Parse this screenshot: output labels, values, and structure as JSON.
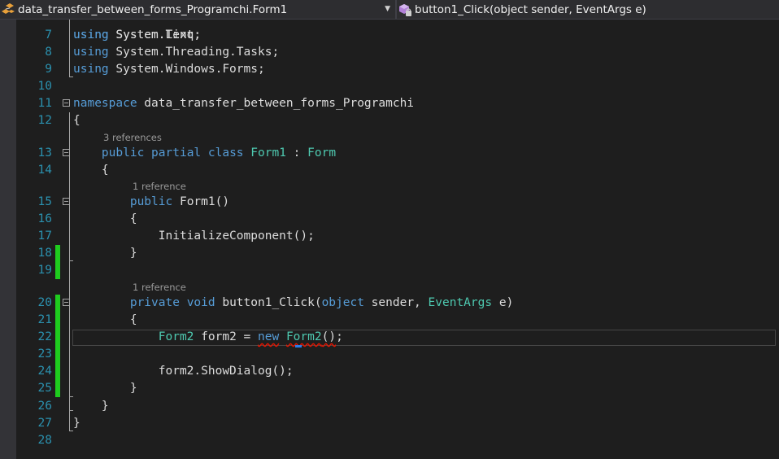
{
  "navbar": {
    "left_combo": "data_transfer_between_forms_Programchi.Form1",
    "right_combo": "button1_Click(object sender, EventArgs e)"
  },
  "colors": {
    "keyword": "#569cd6",
    "type": "#4ec9b0",
    "plain": "#dcdcdc",
    "line_number": "#2b91af",
    "change_bar": "#1ecc1e",
    "error_squiggle": "#e51400"
  },
  "codelens": {
    "form1_class": "3 references",
    "form1_ctor": "1 reference",
    "button1_click": "1 reference"
  },
  "lines": [
    {
      "n": "7",
      "tokens": [
        [
          "kw",
          "using"
        ],
        [
          "pl",
          " System.Text;"
        ]
      ]
    },
    {
      "n": "8",
      "tokens": [
        [
          "kw",
          "using"
        ],
        [
          "pl",
          " System.Threading.Tasks;"
        ]
      ]
    },
    {
      "n": "9",
      "tokens": [
        [
          "kw",
          "using"
        ],
        [
          "pl",
          " System.Windows.Forms;"
        ]
      ]
    },
    {
      "n": "10",
      "tokens": []
    },
    {
      "n": "11",
      "tokens": [
        [
          "kw",
          "namespace"
        ],
        [
          "pl",
          " data_transfer_between_forms_Programchi"
        ]
      ]
    },
    {
      "n": "12",
      "tokens": [
        [
          "pl",
          "{"
        ]
      ]
    },
    {
      "n": "13",
      "tokens": [
        [
          "pl",
          "    "
        ],
        [
          "kw",
          "public"
        ],
        [
          "pl",
          " "
        ],
        [
          "kw",
          "partial"
        ],
        [
          "pl",
          " "
        ],
        [
          "kw",
          "class"
        ],
        [
          "pl",
          " "
        ],
        [
          "ty",
          "Form1"
        ],
        [
          "pl",
          " : "
        ],
        [
          "ty",
          "Form"
        ]
      ]
    },
    {
      "n": "14",
      "tokens": [
        [
          "pl",
          "    {"
        ]
      ]
    },
    {
      "n": "15",
      "tokens": [
        [
          "pl",
          "        "
        ],
        [
          "kw",
          "public"
        ],
        [
          "pl",
          " Form1()"
        ]
      ]
    },
    {
      "n": "16",
      "tokens": [
        [
          "pl",
          "        {"
        ]
      ]
    },
    {
      "n": "17",
      "tokens": [
        [
          "pl",
          "            InitializeComponent();"
        ]
      ]
    },
    {
      "n": "18",
      "tokens": [
        [
          "pl",
          "        }"
        ]
      ]
    },
    {
      "n": "19",
      "tokens": []
    },
    {
      "n": "20",
      "tokens": [
        [
          "pl",
          "        "
        ],
        [
          "kw",
          "private"
        ],
        [
          "pl",
          " "
        ],
        [
          "kw",
          "void"
        ],
        [
          "pl",
          " button1_Click("
        ],
        [
          "kw",
          "object"
        ],
        [
          "pl",
          " sender, "
        ],
        [
          "ty",
          "EventArgs"
        ],
        [
          "pl",
          " e)"
        ]
      ]
    },
    {
      "n": "21",
      "tokens": [
        [
          "pl",
          "        {"
        ]
      ]
    },
    {
      "n": "22",
      "tokens": [
        [
          "pl",
          "            "
        ],
        [
          "ty",
          "Form2"
        ],
        [
          "pl",
          " form2 = "
        ],
        [
          "kw squiggle",
          "new"
        ],
        [
          "pl",
          " "
        ],
        [
          "ty squiggle",
          "Form2"
        ],
        [
          "pl squiggle",
          "()"
        ],
        [
          "pl",
          ";"
        ]
      ]
    },
    {
      "n": "23",
      "tokens": []
    },
    {
      "n": "24",
      "tokens": [
        [
          "pl",
          "            form2.ShowDialog();"
        ]
      ]
    },
    {
      "n": "25",
      "tokens": [
        [
          "pl",
          "        }"
        ]
      ]
    },
    {
      "n": "26",
      "tokens": [
        [
          "pl",
          "    }"
        ]
      ]
    },
    {
      "n": "27",
      "tokens": [
        [
          "pl",
          "}"
        ]
      ]
    },
    {
      "n": "28",
      "tokens": []
    }
  ]
}
